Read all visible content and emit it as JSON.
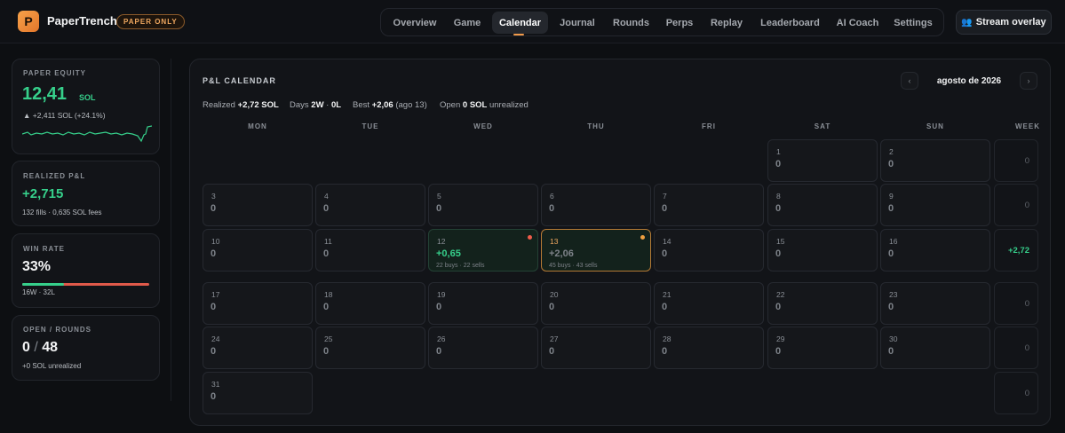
{
  "header": {
    "logo_letter": "P",
    "brand": "PaperTrench",
    "badge": "PAPER ONLY",
    "nav": [
      "Overview",
      "Game",
      "Calendar",
      "Journal",
      "Rounds",
      "Perps",
      "Replay",
      "Leaderboard",
      "AI Coach",
      "Settings"
    ],
    "active_tab": "Calendar",
    "stream_button": "Stream overlay",
    "stream_icon": "person-icon"
  },
  "sidebar": {
    "equity": {
      "label": "PAPER EQUITY",
      "value": "12,41",
      "unit": "SOL",
      "change_arrow": "▲",
      "change": "+2,411 SOL (+24.1%)"
    },
    "realized": {
      "label": "REALIZED P&L",
      "value": "+2,715",
      "detail": "132 fills · 0,635 SOL fees"
    },
    "winrate": {
      "label": "WIN RATE",
      "value": "33%",
      "detail": "16W · 32L",
      "fraction": 0.33
    },
    "open": {
      "label": "OPEN / ROUNDS",
      "open": "0",
      "sep": "/",
      "rounds": "48",
      "detail": "+0 SOL unrealized"
    }
  },
  "calendar": {
    "title": "P&L CALENDAR",
    "month": "agosto de 2026",
    "prev_icon": "chevron-left-icon",
    "next_icon": "chevron-right-icon",
    "summary": {
      "realized_label": "Realized",
      "realized": "+2,72 SOL",
      "days_label": "Days",
      "days_w": "2W",
      "days_sep": " · ",
      "days_l": "0L",
      "best_label": "Best",
      "best": "+2,06",
      "best_date": "(ago 13)",
      "open_label": "Open",
      "open": "0 SOL",
      "open_suffix": "unrealized"
    },
    "weekdays": [
      "MON",
      "TUE",
      "WED",
      "THU",
      "FRI",
      "SAT",
      "SUN",
      "WEEK"
    ],
    "weeks": [
      {
        "days": [
          null,
          null,
          null,
          null,
          null,
          {
            "n": "1",
            "v": "0"
          },
          {
            "n": "2",
            "v": "0"
          }
        ],
        "total": "0"
      },
      {
        "days": [
          {
            "n": "3",
            "v": "0"
          },
          {
            "n": "4",
            "v": "0"
          },
          {
            "n": "5",
            "v": "0"
          },
          {
            "n": "6",
            "v": "0"
          },
          {
            "n": "7",
            "v": "0"
          },
          {
            "n": "8",
            "v": "0"
          },
          {
            "n": "9",
            "v": "0"
          }
        ],
        "total": "0"
      },
      {
        "days": [
          {
            "n": "10",
            "v": "0"
          },
          {
            "n": "11",
            "v": "0"
          },
          {
            "n": "12",
            "v": "+0,65",
            "sub": "22 buys · 22 sells",
            "dot": "#ef5c4a",
            "state": "win"
          },
          {
            "n": "13",
            "v": "+2,06",
            "sub": "45 buys · 43 sells",
            "dot": "#f0a040",
            "state": "today"
          },
          {
            "n": "14",
            "v": "0"
          },
          {
            "n": "15",
            "v": "0"
          },
          {
            "n": "16",
            "v": "0"
          }
        ],
        "total": "+2,72",
        "positive": true
      },
      {
        "days": [
          {
            "n": "17",
            "v": "0"
          },
          {
            "n": "18",
            "v": "0"
          },
          {
            "n": "19",
            "v": "0"
          },
          {
            "n": "20",
            "v": "0"
          },
          {
            "n": "21",
            "v": "0"
          },
          {
            "n": "22",
            "v": "0"
          },
          {
            "n": "23",
            "v": "0"
          }
        ],
        "total": "0"
      },
      {
        "days": [
          {
            "n": "24",
            "v": "0"
          },
          {
            "n": "25",
            "v": "0"
          },
          {
            "n": "26",
            "v": "0"
          },
          {
            "n": "27",
            "v": "0"
          },
          {
            "n": "28",
            "v": "0"
          },
          {
            "n": "29",
            "v": "0"
          },
          {
            "n": "30",
            "v": "0"
          }
        ],
        "total": "0"
      },
      {
        "days": [
          {
            "n": "31",
            "v": "0"
          },
          null,
          null,
          null,
          null,
          null,
          null
        ],
        "total": "0"
      }
    ]
  },
  "colors": {
    "accent": "#f19a4a",
    "positive": "#36d08b",
    "negative": "#ef5c4a"
  }
}
